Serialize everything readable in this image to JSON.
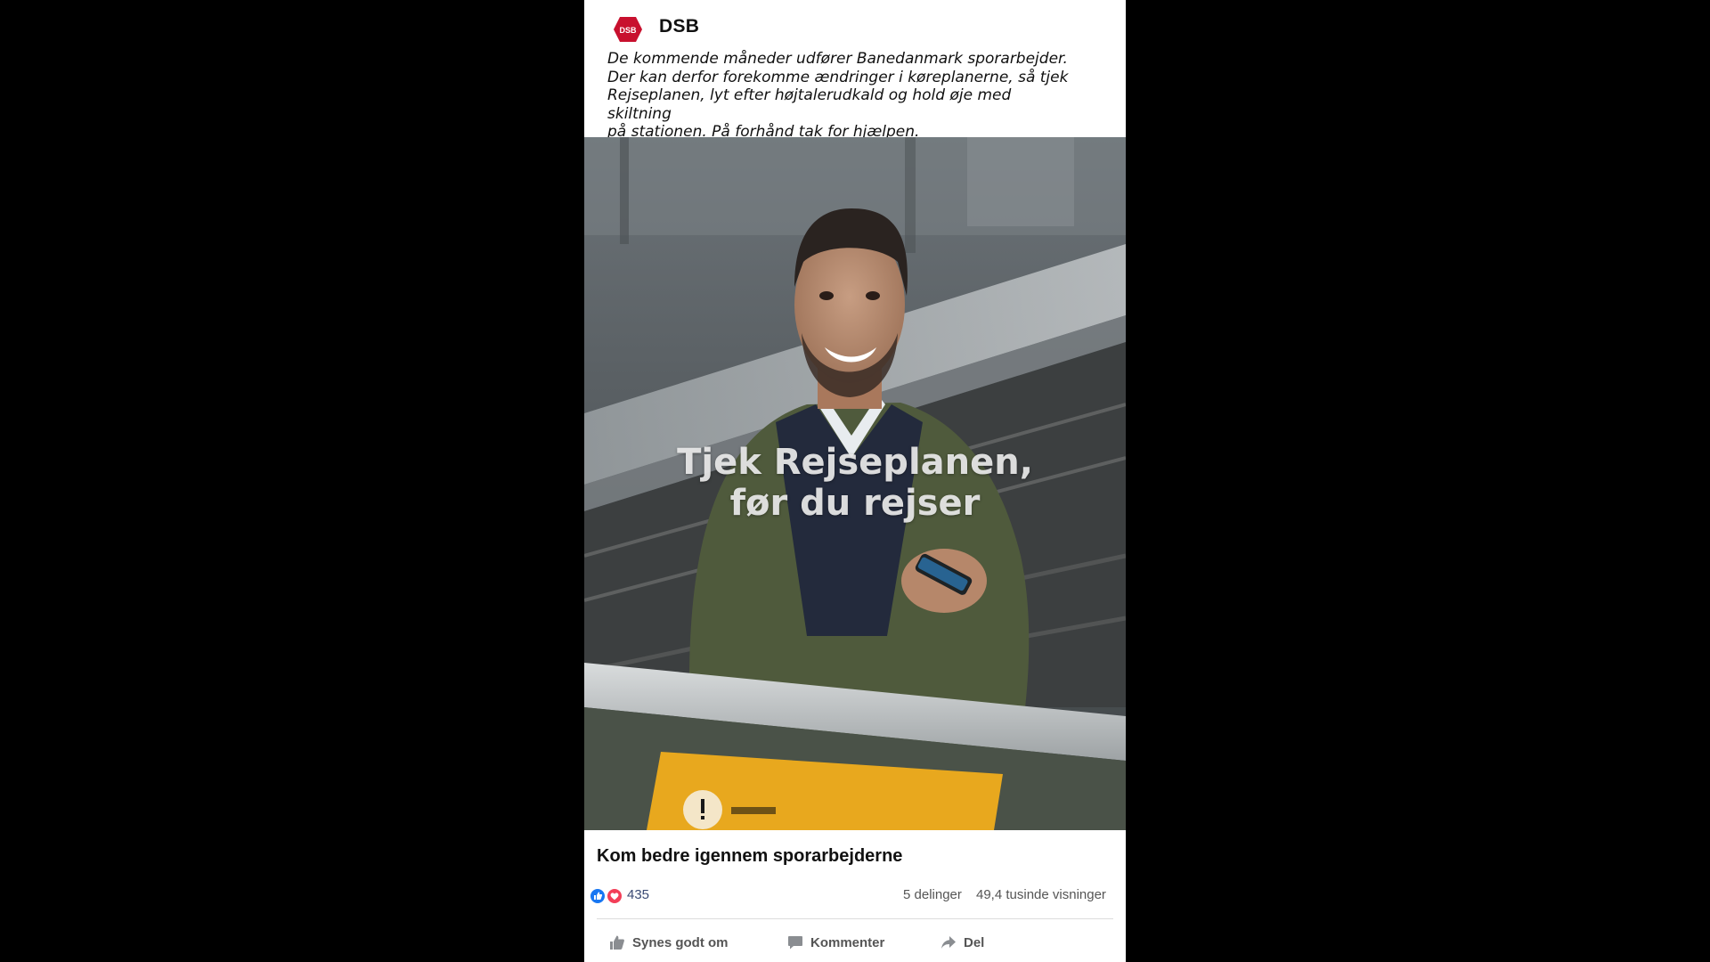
{
  "post": {
    "brand": "DSB",
    "logo_text": "DSB",
    "caption_lines": [
      "De kommende måneder udfører Banedanmark sporarbejder.",
      "Der kan derfor forekomme ændringer i køreplanerne, så tjek",
      "Rejseplanen, lyt efter højtalerudkald og hold øje med skiltning",
      "på stationen. På forhånd tak for hjælpen."
    ],
    "video": {
      "overlay_line1": "Tjek Rejseplanen,",
      "overlay_line2": "før du rejser"
    },
    "headline": "Kom bedre igennem sporarbejderne",
    "stats": {
      "reaction_count": "435",
      "shares": "5 delinger",
      "views": "49,4 tusinde visninger"
    },
    "actions": {
      "like": "Synes godt om",
      "comment": "Kommenter",
      "share": "Del"
    }
  },
  "icons": {
    "logo": "dsb-logo-icon",
    "like_reaction": "like-reaction-icon",
    "love_reaction": "love-reaction-icon",
    "like_action": "thumbs-up-icon",
    "comment_action": "comment-icon",
    "share_action": "share-arrow-icon"
  },
  "colors": {
    "dsb_red": "#c8102e",
    "like_blue": "#1877f2",
    "love_red": "#f33e58",
    "jacket_green": "#4f5a3c",
    "sign_yellow": "#e8a81e"
  }
}
